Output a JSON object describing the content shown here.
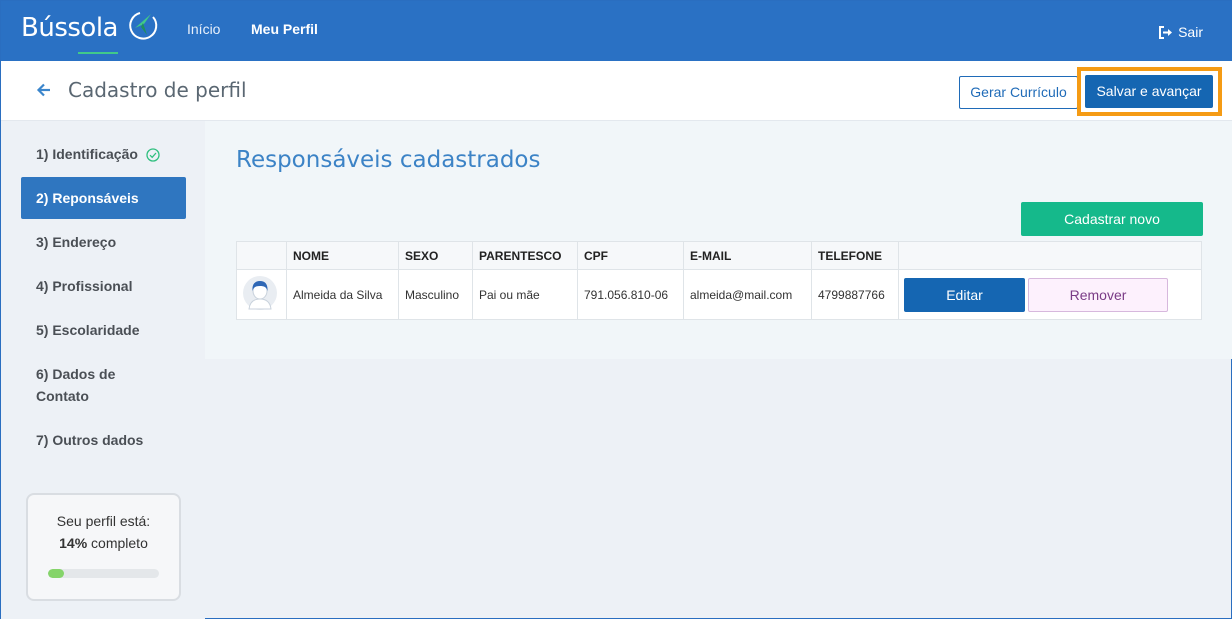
{
  "nav": {
    "brand": "Bússola",
    "links": [
      {
        "label": "Início"
      },
      {
        "label": "Meu Perfil"
      }
    ],
    "logout": "Sair"
  },
  "header": {
    "title": "Cadastro de perfil",
    "btn_resume": "Gerar Currículo",
    "btn_save": "Salvar e avançar"
  },
  "sidebar": {
    "steps": [
      {
        "label": "1) Identificação",
        "completed": true
      },
      {
        "label": "2) Reponsáveis",
        "active": true
      },
      {
        "label": "3) Endereço"
      },
      {
        "label": "4) Profissional"
      },
      {
        "label": "5) Escolaridade"
      },
      {
        "label": "6) Dados de Contato"
      },
      {
        "label": "7) Outros dados"
      }
    ],
    "progress": {
      "line1": "Seu perfil está:",
      "percent": "14%",
      "suffix": "completo",
      "value": 0.14
    }
  },
  "main": {
    "title": "Responsáveis cadastrados",
    "btn_new": "Cadastrar novo",
    "table": {
      "headers": [
        "NOME",
        "SEXO",
        "PARENTESCO",
        "CPF",
        "E-MAIL",
        "TELEFONE"
      ],
      "rows": [
        {
          "nome": "Almeida da Silva",
          "sexo": "Masculino",
          "parentesco": "Pai ou mãe",
          "cpf": "791.056.810-06",
          "email": "almeida@mail.com",
          "telefone": "4799887766",
          "btn_edit": "Editar",
          "btn_remove": "Remover"
        }
      ]
    }
  },
  "colors": {
    "nav_bg": "#2a71c4",
    "primary": "#1566b2",
    "success": "#15b98b",
    "highlight": "#f59b14"
  }
}
